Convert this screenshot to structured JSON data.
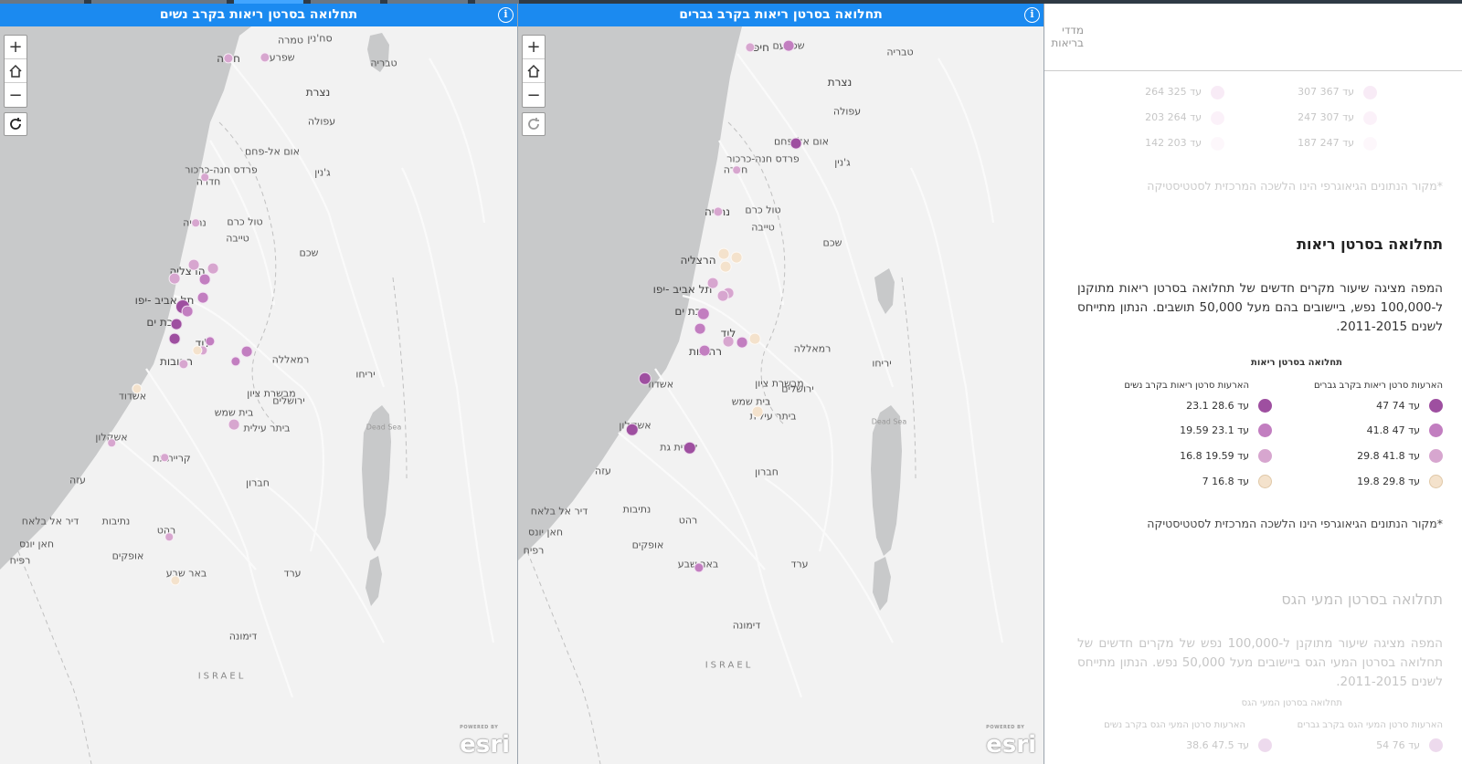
{
  "left_map": {
    "title": "תחלואה בסרטן ריאות בקרב נשים",
    "zoom_in": "+",
    "zoom_out": "−",
    "places": [
      {
        "t": "חיפה"
      },
      {
        "t": "שפרעם"
      },
      {
        "t": "טבריה"
      },
      {
        "t": "סח'נין"
      },
      {
        "t": "טמרה"
      },
      {
        "t": "נצרת"
      },
      {
        "t": "עפולה"
      },
      {
        "t": "אום אל-פחם"
      },
      {
        "t": "פרדס חנה-כרכור"
      },
      {
        "t": "חדרה"
      },
      {
        "t": "ג'נין"
      },
      {
        "t": "נתניה"
      },
      {
        "t": "טול כרם"
      },
      {
        "t": "טייבה"
      },
      {
        "t": "שכם"
      },
      {
        "t": "הרצליה"
      },
      {
        "t": "תל אביב -יפו"
      },
      {
        "t": "בת ים"
      },
      {
        "t": "לוד"
      },
      {
        "t": "רחובות"
      },
      {
        "t": "רמאללה"
      },
      {
        "t": "יריחו"
      },
      {
        "t": "אשדוד"
      },
      {
        "t": "מבשרת ציון"
      },
      {
        "t": "ירושלים"
      },
      {
        "t": "בית שמש"
      },
      {
        "t": "ביתר עילית"
      },
      {
        "t": "אשקלון"
      },
      {
        "t": "קריית גת"
      },
      {
        "t": "עזה"
      },
      {
        "t": "חברון"
      },
      {
        "t": "דיר אל בלאח"
      },
      {
        "t": "נתיבות"
      },
      {
        "t": "חאן יונס"
      },
      {
        "t": "רפיח"
      },
      {
        "t": "אופקים"
      },
      {
        "t": "רהט"
      },
      {
        "t": "באר שבע"
      },
      {
        "t": "ערד"
      },
      {
        "t": "דימונה"
      },
      {
        "t": "ISRAEL"
      },
      {
        "t": "Dead Sea"
      }
    ],
    "dots": [
      {
        "c": "#d7a6cf"
      },
      {
        "c": "#d7a6cf"
      },
      {
        "c": "#d7a6cf"
      },
      {
        "c": "#d7a6cf"
      },
      {
        "c": "#d7a6cf"
      },
      {
        "c": "#c27ec0"
      },
      {
        "c": "#c27ec0"
      },
      {
        "c": "#9e4fa0"
      },
      {
        "c": "#c27ec0"
      },
      {
        "c": "#9e4fa0"
      },
      {
        "c": "#9e4fa0"
      },
      {
        "c": "#c27ec0"
      },
      {
        "c": "#c27ec0"
      },
      {
        "c": "#d7a6cf"
      },
      {
        "c": "#d7a6cf"
      },
      {
        "c": "#f4e2cc"
      },
      {
        "c": "#f4e2cc"
      },
      {
        "c": "#d7a6cf"
      },
      {
        "c": "#c27ec0"
      },
      {
        "c": "#d7a6cf"
      },
      {
        "c": "#d7a6cf"
      },
      {
        "c": "#d7a6cf"
      },
      {
        "c": "#f4e2cc"
      },
      {
        "c": "#d7a6cf"
      },
      {
        "c": "#d7a6cf"
      }
    ]
  },
  "right_map": {
    "title": "תחלואה בסרטן ריאות בקרב גברים",
    "zoom_in": "+",
    "zoom_out": "−",
    "places": [
      {
        "t": "חיפה"
      },
      {
        "t": "שפרעם"
      },
      {
        "t": "טבריה"
      },
      {
        "t": "נצרת"
      },
      {
        "t": "עפולה"
      },
      {
        "t": "אום אל-פחם"
      },
      {
        "t": "ג'נין"
      },
      {
        "t": "פרדס חנה-כרכור"
      },
      {
        "t": "חדרה"
      },
      {
        "t": "נתניה"
      },
      {
        "t": "טול כרם"
      },
      {
        "t": "טייבה"
      },
      {
        "t": "שכם"
      },
      {
        "t": "הרצליה"
      },
      {
        "t": "תל אביב -יפו"
      },
      {
        "t": "בת ים"
      },
      {
        "t": "לוד"
      },
      {
        "t": "רחובות"
      },
      {
        "t": "רמאללה"
      },
      {
        "t": "יריחו"
      },
      {
        "t": "אשדוד"
      },
      {
        "t": "מבשרת ציון"
      },
      {
        "t": "ירושלים"
      },
      {
        "t": "בית שמש"
      },
      {
        "t": "ביתר עילית"
      },
      {
        "t": "אשקלון"
      },
      {
        "t": "קריית גת"
      },
      {
        "t": "עזה"
      },
      {
        "t": "חברון"
      },
      {
        "t": "דיר אל בלאח"
      },
      {
        "t": "נתיבות"
      },
      {
        "t": "חאן יונס"
      },
      {
        "t": "רפיח"
      },
      {
        "t": "רהט"
      },
      {
        "t": "אופקים"
      },
      {
        "t": "באר שבע"
      },
      {
        "t": "ערד"
      },
      {
        "t": "דימונה"
      },
      {
        "t": "ISRAEL"
      },
      {
        "t": "Dead Sea"
      }
    ],
    "dots": [
      {
        "c": "#d7a6cf"
      },
      {
        "c": "#c27ec0"
      },
      {
        "c": "#9e4fa0"
      },
      {
        "c": "#d7a6cf"
      },
      {
        "c": "#d7a6cf"
      },
      {
        "c": "#f4e2cc"
      },
      {
        "c": "#f4e2cc"
      },
      {
        "c": "#f4e2cc"
      },
      {
        "c": "#d7a6cf"
      },
      {
        "c": "#d7a6cf"
      },
      {
        "c": "#d7a6cf"
      },
      {
        "c": "#c27ec0"
      },
      {
        "c": "#c27ec0"
      },
      {
        "c": "#d7a6cf"
      },
      {
        "c": "#c27ec0"
      },
      {
        "c": "#f4e2cc"
      },
      {
        "c": "#c27ec0"
      },
      {
        "c": "#f4e2cc"
      },
      {
        "c": "#9e4fa0"
      },
      {
        "c": "#9e4fa0"
      },
      {
        "c": "#9e4fa0"
      },
      {
        "c": "#c27ec0"
      }
    ]
  },
  "side": {
    "header_label": "מדדי בריאות",
    "faded_top_rows": [
      {
        "men": "307 עד 367",
        "women": "264 עד 325"
      },
      {
        "men": "247 עד 307",
        "women": "203 עד 264"
      },
      {
        "men": "187 עד 247",
        "women": "142 עד 203"
      }
    ],
    "faded_source": "*מקור הנתונים הגיאוגרפי הינו הלשכה המרכזית לסטטיסטיקה",
    "lung_title": "תחלואה בסרטן ריאות",
    "lung_para": "המפה מציגה שיעור מקרים חדשים של תחלואה בסרטן ריאות מתוקנן ל-100,000 נפש, ביישובים בהם מעל 50,000 תושבים. הנתון מתייחס לשנים 2011-2015.",
    "legend_title": "תחלואה בסרטן ריאות",
    "legend_hdr_men": "הארעות סרטן ריאות בקרב גברים",
    "legend_hdr_women": "הארעות סרטן ריאות בקרב נשים",
    "legend_rows": [
      {
        "men": "47 עד 74",
        "women": "23.1 עד 28.6",
        "color": "#9e4fa0"
      },
      {
        "men": "41.8 עד 47",
        "women": "19.59 עד 23.1",
        "color": "#c27ec0"
      },
      {
        "men": "29.8 עד 41.8",
        "women": "16.8 עד 19.59",
        "color": "#d7a6cf"
      },
      {
        "men": "19.8 עד 29.8",
        "women": "7 עד 16.8",
        "color": "#f4e2cc"
      }
    ],
    "lung_source": "*מקור הנתונים הגיאוגרפי הינו הלשכה המרכזית לסטטיסטיקה",
    "stomach_title": "תחלואה בסרטן המעי הגס",
    "stomach_para": "המפה מציגה שיעור מתוקנן ל-100,000 נפש של מקרים חדשים של תחלואה בסרטן המעי הגס ביישובים מעל 50,000 נפש. הנתון מתייחס לשנים 2011-2015.",
    "stomach_legend_title": "תחלואה בסרטן המעי הגס",
    "stomach_hdr_men": "הארעות סרטן המעי הגס בקרב גברים",
    "stomach_hdr_women": "הארעות סרטן המעי הגס בקרב נשים",
    "stomach_row": {
      "men": "54 עד 76",
      "women": "38.6 עד 47.5"
    },
    "esri_powered": "POWERED BY",
    "esri_logo": "esri"
  }
}
